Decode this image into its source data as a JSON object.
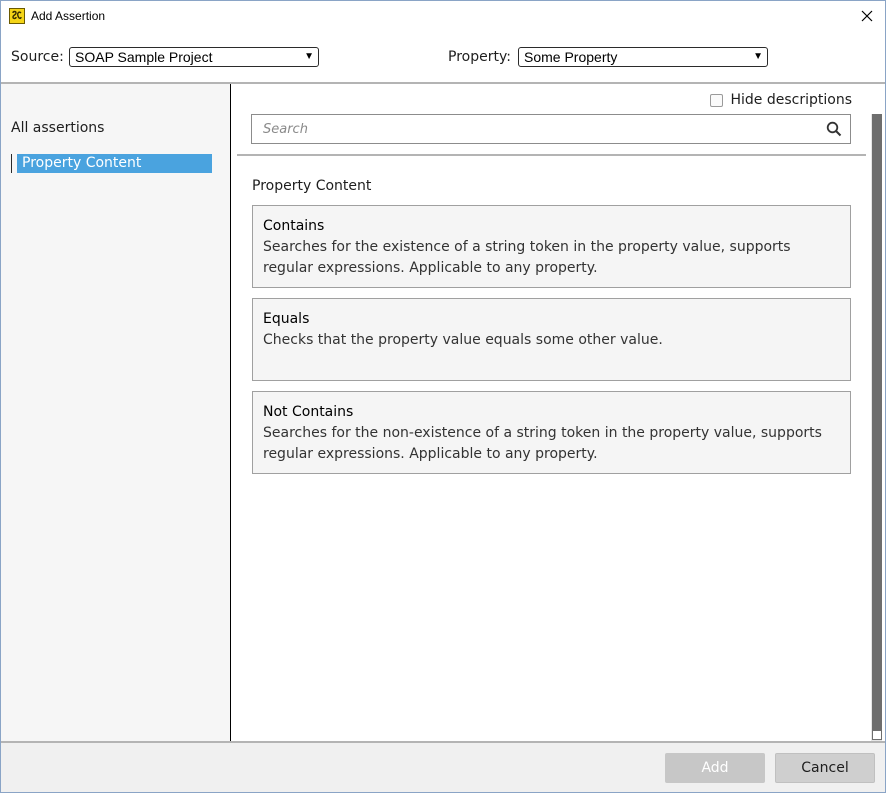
{
  "window": {
    "title": "Add Assertion",
    "app_icon": "soapui-icon",
    "close_icon": "close-icon"
  },
  "source": {
    "label": "Source:",
    "value": "SOAP Sample Project"
  },
  "property": {
    "label": "Property:",
    "value": "Some Property"
  },
  "sidebar": {
    "heading": "All assertions",
    "items": [
      {
        "label": "Property Content",
        "selected": true
      }
    ]
  },
  "options": {
    "hide_descriptions_label": "Hide descriptions",
    "hide_descriptions_checked": false
  },
  "search": {
    "placeholder": "Search",
    "icon": "search-icon"
  },
  "main": {
    "section_title": "Property Content",
    "assertions": [
      {
        "name": "Contains",
        "description": "Searches for the existence of a string token in the property value, supports regular expressions. Applicable to any property."
      },
      {
        "name": "Equals",
        "description": "Checks that the property value equals some other value."
      },
      {
        "name": "Not Contains",
        "description": "Searches for the non-existence of a string token in the property value, supports regular expressions. Applicable to any property."
      }
    ]
  },
  "footer": {
    "add_label": "Add",
    "add_enabled": false,
    "cancel_label": "Cancel"
  },
  "colors": {
    "selection": "#4aa3df",
    "sidebar_bg": "#f6f6f6",
    "card_bg": "#f5f5f5"
  }
}
